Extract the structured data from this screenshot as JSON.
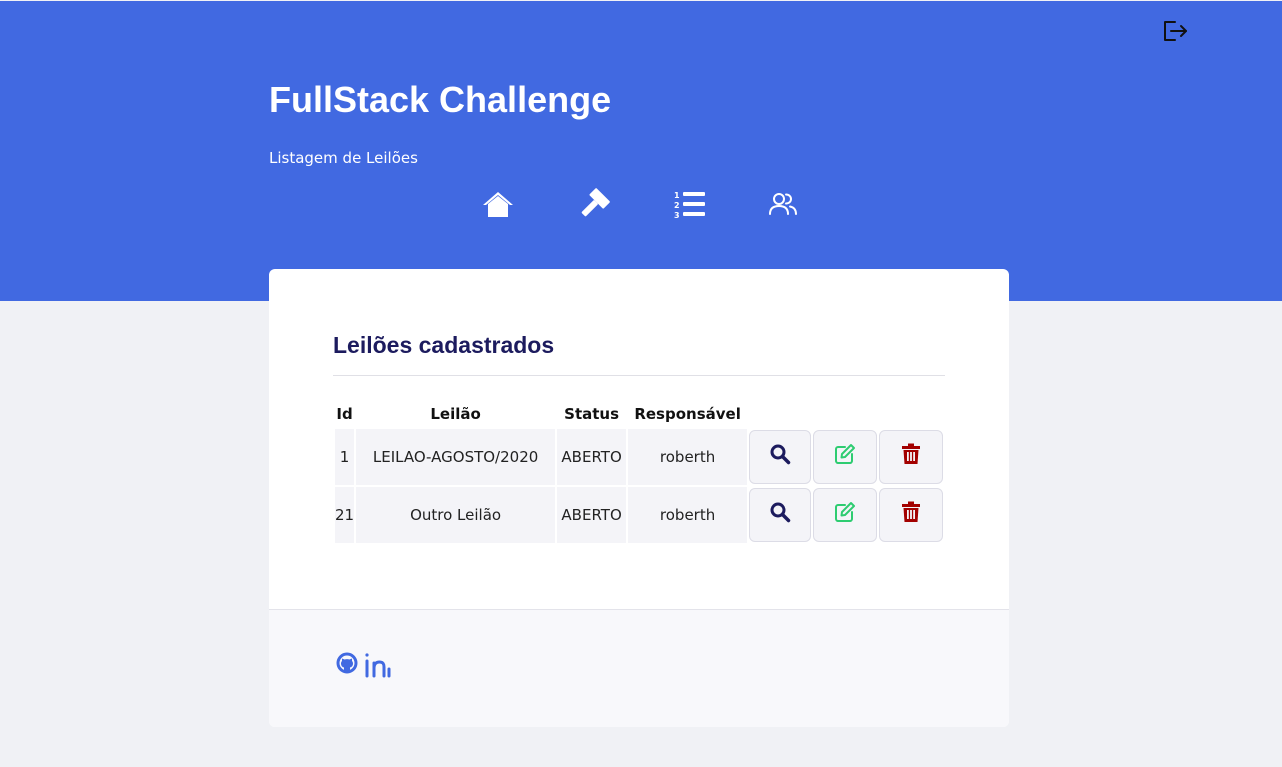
{
  "header": {
    "title": "FullStack Challenge",
    "subtitle": "Listagem de Leilões",
    "background_color": "#4169e1",
    "logout_icon": "logout-icon",
    "nav": [
      {
        "icon": "home-icon"
      },
      {
        "icon": "gavel-icon"
      },
      {
        "icon": "ordered-list-icon"
      },
      {
        "icon": "users-icon"
      }
    ]
  },
  "card": {
    "title": "Leilões cadastrados",
    "columns": [
      "Id",
      "Leilão",
      "Status",
      "Responsável"
    ],
    "rows": [
      {
        "id": "1",
        "leilao": "LEILAO-AGOSTO/2020",
        "status": "ABERTO",
        "responsavel": "roberth"
      },
      {
        "id": "21",
        "leilao": "Outro Leilão",
        "status": "ABERTO",
        "responsavel": "roberth"
      }
    ],
    "actions": [
      {
        "icon": "search-icon",
        "color": "#1c1b5e"
      },
      {
        "icon": "edit-icon",
        "color": "#2ecc71"
      },
      {
        "icon": "trash-icon",
        "color": "#a30000"
      }
    ]
  },
  "footer": {
    "links": [
      {
        "icon": "github-icon",
        "color": "#4169e1"
      },
      {
        "icon": "linkedin-icon",
        "color": "#4169e1"
      }
    ]
  }
}
